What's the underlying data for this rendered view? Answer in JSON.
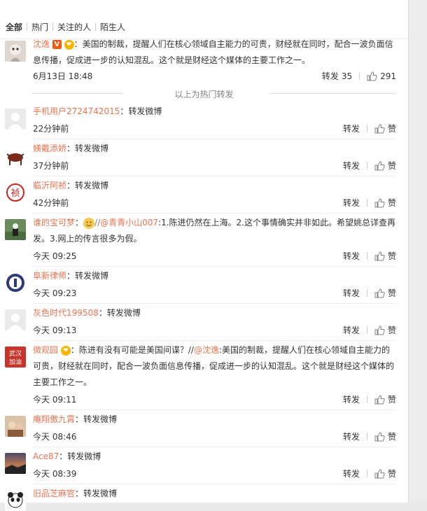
{
  "tabs": [
    "全部",
    "热门",
    "关注的人",
    "陌生人"
  ],
  "hot": {
    "name": "沈逸",
    "text": "：美国的制裁，提醒人们在核心领域自主能力的可贵，财经就在同时，配合一波负面信息传播，促成进一步的认知混乱。这个就是财经这个媒体的主要工作之一。",
    "time": "6月13日 18:48",
    "repost_label": "转发",
    "repost_count": "35",
    "like_count": "291"
  },
  "divider": "以上为热门转发",
  "rows": [
    {
      "name": "手机用户2724742015",
      "text": "：转发微博",
      "time": "22分钟前",
      "repost": "转发",
      "like": "赞"
    },
    {
      "name": "姨戴添娇",
      "text": "：转发微博",
      "time": "37分钟前",
      "repost": "转发",
      "like": "赞"
    },
    {
      "name": "临沂阿祯",
      "text": "：转发微博",
      "time": "42分钟前",
      "repost": "转发",
      "like": "赞"
    },
    {
      "name": "谁的宝可梦",
      "text_pre": "：",
      "mention": "@青青小山007",
      "text": ":1.陈进仍然在上海。2.这个事情确实并非如此。希望姚总详查再发。3.网上的传言很多为假。",
      "time": "今天 09:25",
      "repost": "转发",
      "like": "赞"
    },
    {
      "name": "阜新律师",
      "text": "：转发微博",
      "time": "今天 09:23",
      "repost": "转发",
      "like": "赞"
    },
    {
      "name": "灰色时代199508",
      "text": "：转发微博",
      "time": "今天 09:13",
      "repost": "转发",
      "like": "赞"
    },
    {
      "name": "微观园",
      "text_pre": "：陈进有没有可能是美国间谍？//",
      "mention": "@沈逸",
      "text": ":美国的制裁，提醒人们在核心领域自主能力的可贵，财经就在同时，配合一波负面信息传播，促成进一步的认知混乱。这个就是财经这个媒体的主要工作之一。",
      "time": "今天 09:11",
      "repost": "转发",
      "like": "赞"
    },
    {
      "name": "庵翔傲九霄",
      "text": "：转发微博",
      "time": "今天 08:46",
      "repost": "转发",
      "like": "赞"
    },
    {
      "name": "Ace87",
      "text": "：转发微博",
      "time": "今天 08:39",
      "repost": "转发",
      "like": "赞"
    },
    {
      "name": "旧品芝麻官",
      "text": "：转发微博",
      "time": "",
      "repost": "",
      "like": ""
    }
  ],
  "avatar_text": {
    "wuhan": "武汉\n加油"
  }
}
